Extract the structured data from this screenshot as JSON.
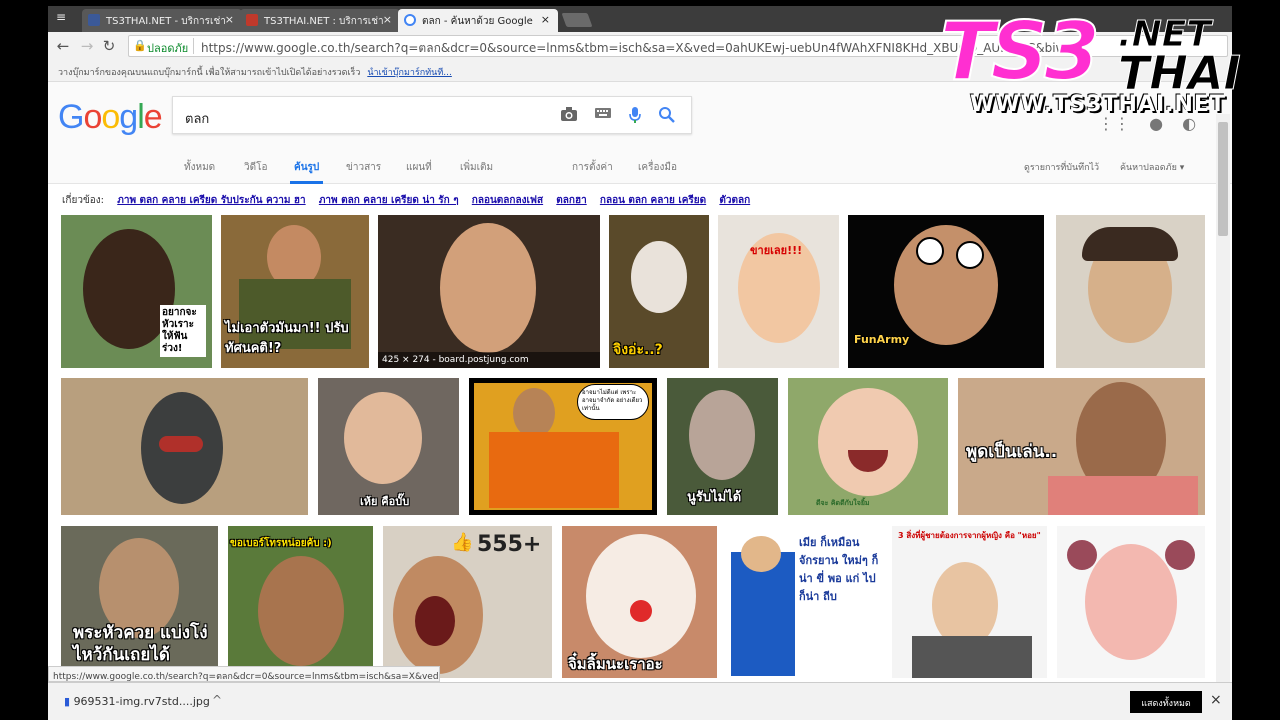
{
  "browser": {
    "menu_icon": "≡",
    "tabs": [
      {
        "title": "TS3THAI.NET - บริการเช่า",
        "favicon_color": "#3b5998",
        "favicon": "facebook-icon"
      },
      {
        "title": "TS3THAI.NET : บริการเช่า",
        "favicon_color": "#c0392b",
        "favicon": "site-icon"
      },
      {
        "title": "ตลก - ค้นหาด้วย Google",
        "favicon_color": "#4285f4",
        "favicon": "google-icon"
      }
    ],
    "tab_close": "×",
    "secure_label": "ปลอดภัย",
    "url": "https://www.google.co.th/search?q=ตลก&dcr=0&source=lnms&tbm=isch&sa=X&ved=0ahUKEwj-uebUn4fWAhXFNI8KHd_XBUQQ_AUICygC&biw=1",
    "bookmark_hint": "วางบุ๊กมาร์กของคุณบนแถบบุ๊กมาร์กนี้ เพื่อให้สามารถเข้าไปเปิดได้อย่างรวดเร็ว",
    "bookmark_link": "นำเข้าบุ๊กมาร์กทันที..."
  },
  "google": {
    "logo_letters": [
      "G",
      "o",
      "o",
      "g",
      "l",
      "e"
    ],
    "logo_colors": [
      "#4285f4",
      "#ea4335",
      "#fbbc05",
      "#4285f4",
      "#34a853",
      "#ea4335"
    ],
    "query": "ตลก",
    "tabs": [
      "ทั้งหมด",
      "วิดีโอ",
      "ค้นรูป",
      "ข่าวสาร",
      "แผนที่",
      "เพิ่มเติม"
    ],
    "active_tab": "ค้นรูป",
    "tools": [
      "การตั้งค่า",
      "เครื่องมือ"
    ],
    "saved": "ดูรายการที่บันทึกไว้",
    "safesearch": "ค้นหาปลอดภัย ▾"
  },
  "related": {
    "label": "เกี่ยวข้อง:",
    "items": [
      "ภาพ ตลก คลาย เครียด รับประกัน ความ ฮา",
      "ภาพ ตลก คลาย เครียด น่า รัก ๆ",
      "กลอนตลกลงเฟส",
      "ตลกฮา",
      "กลอน ตลก คลาย เครียด",
      "ตัวตลก"
    ]
  },
  "images": [
    {
      "caption": "อยากจะ หัวเราะ ให้ฟัน ร่วง!",
      "bg": "#6b8c55"
    },
    {
      "caption": "ไม่เอาตัวมันมา!! ปรับทัศนคติ!?",
      "bg": "#8a6a3a"
    },
    {
      "caption": "",
      "bg": "#3a2c22",
      "dims": "425 × 274 - board.postjung.com"
    },
    {
      "caption": "จิงอ่ะ..?",
      "bg": "#5a4a2a"
    },
    {
      "caption": "ขายเลย!!!",
      "bg": "#e8e3dc"
    },
    {
      "caption": "FunArmy",
      "bg": "#050505"
    },
    {
      "caption": "",
      "bg": "#d9d2c6"
    },
    {
      "caption": "",
      "bg": "#b89f7e"
    },
    {
      "caption": "เห้ย คือบั๊บ",
      "bg": "#6f6760"
    },
    {
      "caption": "อาจมาไม่ดีแต่ เพราะอาจมาจำกัด อย่างเดียวเท่านั้น",
      "bg": "#e0a020"
    },
    {
      "caption": "นูรับไม่ได้",
      "bg": "#4a5a3a"
    },
    {
      "caption": "ดีจะ คิดดีกับใจยิ้ม",
      "bg": "#8fa86a"
    },
    {
      "caption": "พูดเป็นเล่น..",
      "bg": "#c9a98a"
    },
    {
      "caption": "พระหัวควย แบ่งโง่ไหว้กันเถยได้",
      "bg": "#6a6a5a"
    },
    {
      "caption": "ขอเบอร์โทรหน่อยค้บ :)",
      "bg": "#5a7a3a"
    },
    {
      "caption": "555+",
      "bg": "#d8d0c4"
    },
    {
      "caption": "จิ๋มลิ้มนะเราอะ",
      "bg": "#c88a6a"
    },
    {
      "caption": "เมีย ก็เหมือน จักรยาน ใหม่ๆ ก็น่า ขี่ พอ แก่ ไปก็น่า ถีบ",
      "bg": "#ffffff"
    },
    {
      "caption": "3 สิ่งที่ผู้ชายต้องการจากผู้หญิง คือ \"หอย\"",
      "bg": "#f4f4f4"
    },
    {
      "caption": "",
      "bg": "#f6f6f6"
    }
  ],
  "status_url": "https://www.google.co.th/search?q=ตลก&dcr=0&source=lnms&tbm=isch&sa=X&ved...",
  "download": {
    "file": "969531-img.rv7std....jpg",
    "show_all": "แสดงทั้งหมด",
    "close": "×"
  },
  "watermark": {
    "logo": "TS3",
    "net": ".NET",
    "thai": "THAI",
    "site": "WWW.TS3THAI.NET"
  }
}
